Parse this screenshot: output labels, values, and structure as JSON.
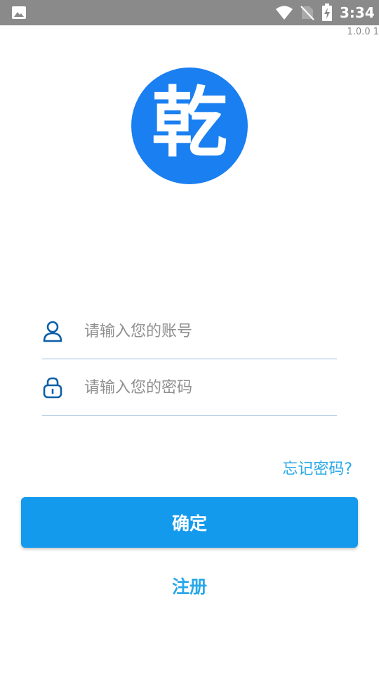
{
  "status_bar": {
    "time": "3:34",
    "icons": [
      "gallery-icon",
      "wifi-icon",
      "no-sim-icon",
      "battery-charging-icon"
    ]
  },
  "version": "1.0.0 1",
  "logo": {
    "char": "乾",
    "color": "#1a7ff0"
  },
  "form": {
    "account": {
      "icon": "user-icon",
      "placeholder": "请输入您的账号",
      "value": ""
    },
    "password": {
      "icon": "lock-icon",
      "placeholder": "请输入您的密码",
      "value": ""
    },
    "forgot_label": "忘记密码?",
    "confirm_label": "确定",
    "register_label": "注册"
  },
  "colors": {
    "status_bar": "#8a8a8a",
    "primary_button": "#139aed",
    "link": "#29a8e8",
    "icon": "#0d5fa8"
  }
}
